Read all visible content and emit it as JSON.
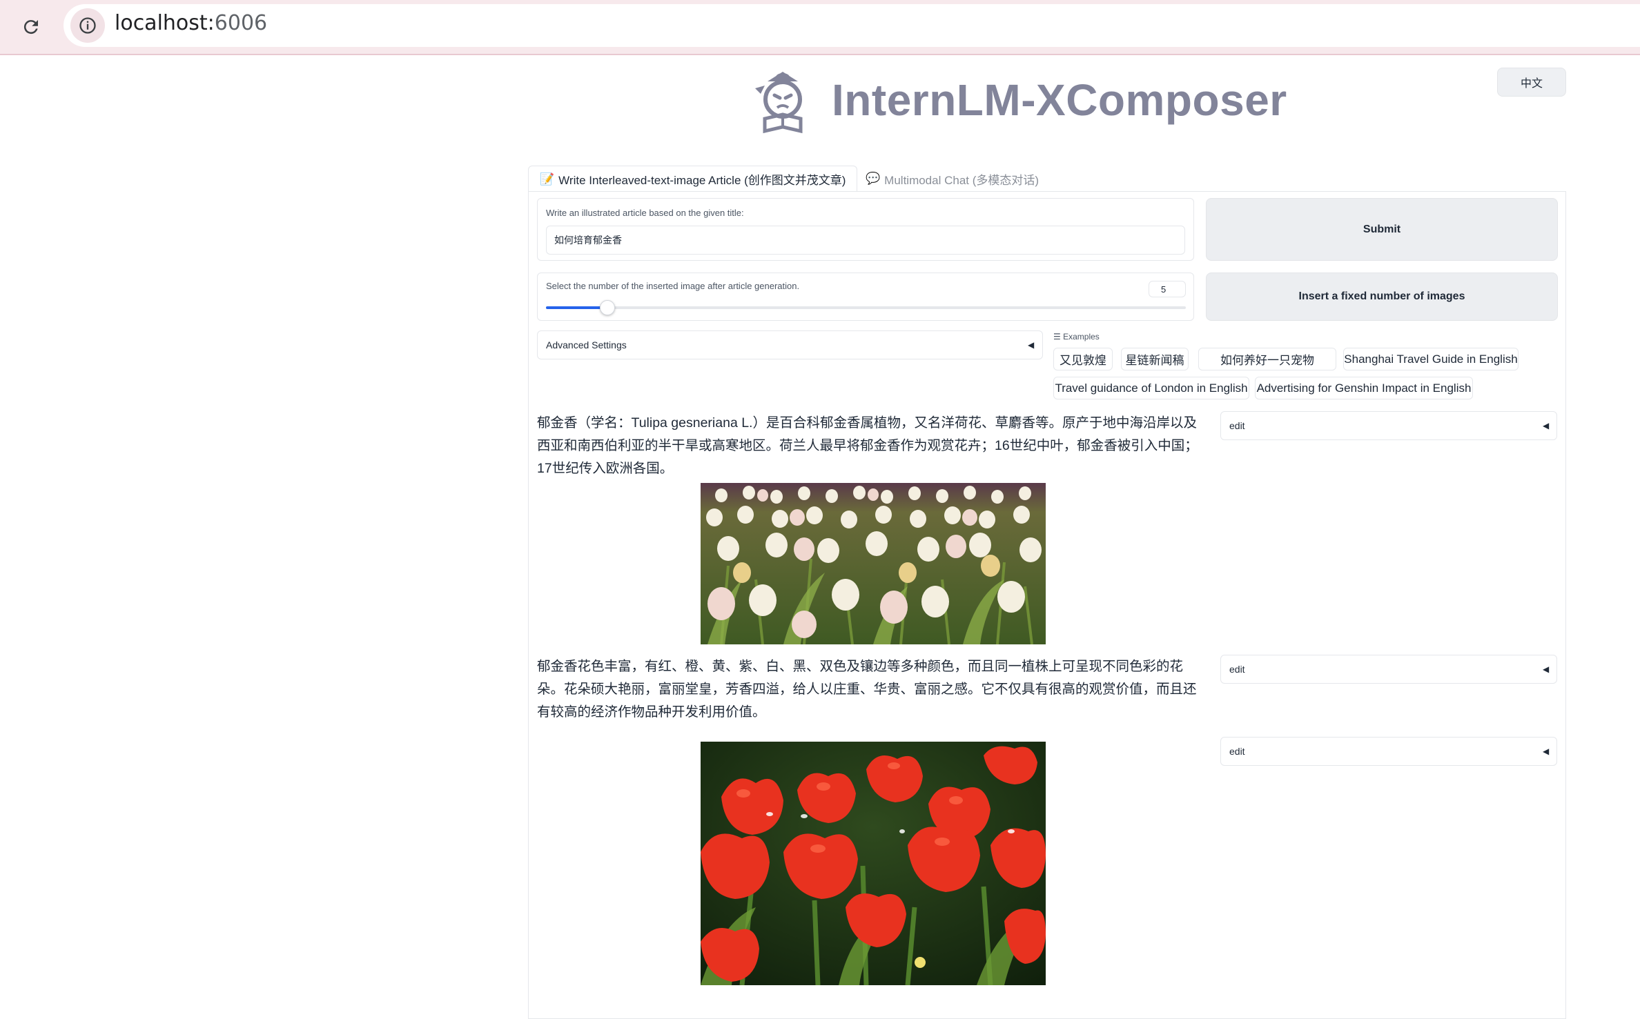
{
  "browser": {
    "url_host": "localhost:",
    "url_port": "6006"
  },
  "header": {
    "lang_button": "中文",
    "app_title": "InternLM-XComposer"
  },
  "tabs": [
    {
      "icon": "📝",
      "label": "Write Interleaved-text-image Article (创作图文并茂文章)",
      "active": true
    },
    {
      "icon": "💬",
      "label": "Multimodal Chat (多模态对话)",
      "active": false
    }
  ],
  "form": {
    "title_label": "Write an illustrated article based on the given title:",
    "title_value": "如何培育郁金香",
    "submit_label": "Submit",
    "slider_label": "Select the number of the inserted image after article generation.",
    "slider_value": "5",
    "slider_fraction": 0.096,
    "insert_label": "Insert a fixed number of images",
    "advanced_label": "Advanced Settings"
  },
  "examples": {
    "label": "Examples",
    "items": [
      "又见敦煌",
      "星链新闻稿",
      "如何养好一只宠物",
      "Shanghai Travel Guide in English",
      "Travel guidance of London in English",
      "Advertising for Genshin Impact in English"
    ]
  },
  "article": {
    "paragraph_1": "郁金香（学名：Tulipa gesneriana L.）是百合科郁金香属植物，又名洋荷花、草麝香等。原产于地中海沿岸以及西亚和南西伯利亚的半干旱或高寒地区。荷兰人最早将郁金香作为观赏花卉；16世纪中叶，郁金香被引入中国；17世纪传入欧洲各国。",
    "paragraph_2": "郁金香花色丰富，有红、橙、黄、紫、白、黑、双色及镶边等多种颜色，而且同一植株上可呈现不同色彩的花朵。花朵硕大艳丽，富丽堂皇，芳香四溢，给人以庄重、华贵、富丽之感。它不仅具有很高的观赏价值，而且还有较高的经济作物品种开发利用价值。",
    "edit_label": "edit"
  },
  "colors": {
    "accent": "#2563eb",
    "title_gray": "#82849a",
    "tulip_red": "#e8321f"
  }
}
